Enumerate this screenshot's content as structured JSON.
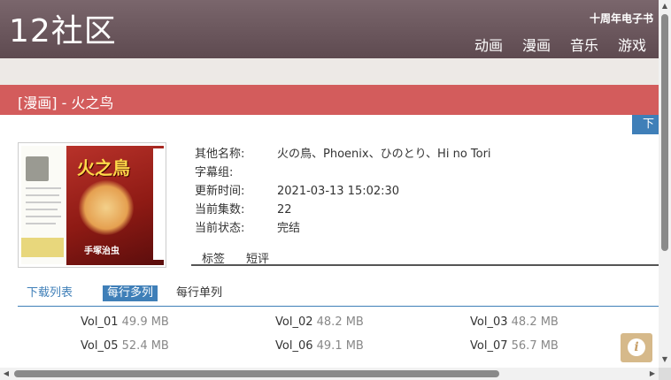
{
  "header": {
    "logo": "12社区",
    "anniversary": "十周年电子书",
    "nav": [
      "动画",
      "漫画",
      "音乐",
      "游戏"
    ]
  },
  "title_bar": {
    "text": "[漫画] - 火之鸟"
  },
  "download_button": {
    "label": "下"
  },
  "cover": {
    "title_text": "火之鳥",
    "author_text": "手塚治虫"
  },
  "info": {
    "rows": [
      {
        "label": "其他名称:",
        "value": "火の鳥、Phoenix、ひのとり、Hi no Tori"
      },
      {
        "label": "字幕组:",
        "value": ""
      },
      {
        "label": "更新时间:",
        "value": "2021-03-13 15:02:30"
      },
      {
        "label": "当前集数:",
        "value": "22"
      },
      {
        "label": "当前状态:",
        "value": "完结"
      }
    ]
  },
  "tabs": [
    "标签",
    "短评"
  ],
  "download_list": {
    "title": "下载列表",
    "mode_multi": "每行多列",
    "mode_single": "每行单列",
    "files": [
      {
        "name": "Vol_01",
        "size": "49.9 MB"
      },
      {
        "name": "Vol_02",
        "size": "48.2 MB"
      },
      {
        "name": "Vol_03",
        "size": "48.2 MB"
      },
      {
        "name": "Vol_05",
        "size": "52.4 MB"
      },
      {
        "name": "Vol_06",
        "size": "49.1 MB"
      },
      {
        "name": "Vol_07",
        "size": "56.7 MB"
      }
    ]
  },
  "info_button": {
    "icon": "info-icon",
    "glyph": "i"
  },
  "colors": {
    "header": "#6b575d",
    "title_bar": "#d35c5c",
    "accent_blue": "#3f7fb8",
    "info_button": "#d6b98a"
  }
}
